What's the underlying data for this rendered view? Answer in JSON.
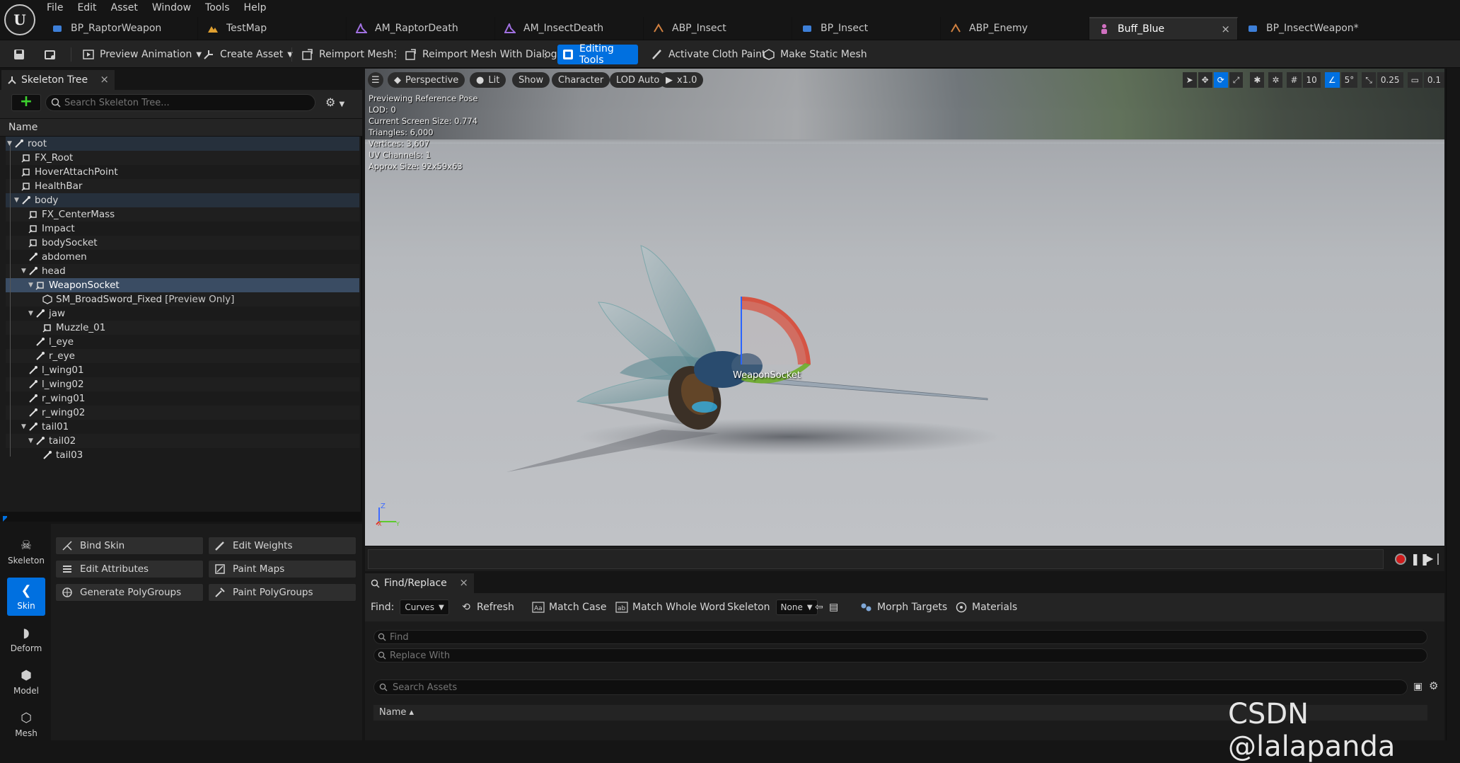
{
  "menu": [
    "File",
    "Edit",
    "Asset",
    "Window",
    "Tools",
    "Help"
  ],
  "tabs": [
    {
      "label": "BP_RaptorWeapon",
      "icon": "blueprint-icon"
    },
    {
      "label": "TestMap",
      "icon": "level-icon"
    },
    {
      "label": "AM_RaptorDeath",
      "icon": "anim-montage-icon"
    },
    {
      "label": "AM_InsectDeath",
      "icon": "anim-montage-icon"
    },
    {
      "label": "ABP_Insect",
      "icon": "anim-blueprint-icon"
    },
    {
      "label": "BP_Insect",
      "icon": "blueprint-icon"
    },
    {
      "label": "ABP_Enemy",
      "icon": "anim-blueprint-icon"
    },
    {
      "label": "Buff_Blue",
      "icon": "skeletal-mesh-icon",
      "active": true,
      "close": "×"
    },
    {
      "label": "BP_InsectWeapon*",
      "icon": "blueprint-icon"
    }
  ],
  "toolbar": {
    "preview_animation": "Preview Animation",
    "create_asset": "Create Asset",
    "reimport_mesh": "Reimport Mesh",
    "reimport_dialog": "Reimport Mesh With Dialog",
    "editing_tools": "Editing Tools",
    "cloth_paint": "Activate Cloth Paint",
    "static_mesh": "Make Static Mesh"
  },
  "skeleton_tree": {
    "tab_label": "Skeleton Tree",
    "close": "×",
    "search_placeholder": "Search Skeleton Tree...",
    "column": "Name",
    "rows": [
      {
        "label": "root",
        "type": "bone",
        "depth": 0,
        "arrow": true
      },
      {
        "label": "FX_Root",
        "type": "socket",
        "depth": 1
      },
      {
        "label": "HoverAttachPoint",
        "type": "socket",
        "depth": 1
      },
      {
        "label": "HealthBar",
        "type": "socket",
        "depth": 1
      },
      {
        "label": "body",
        "type": "bone",
        "depth": 1,
        "arrow": true
      },
      {
        "label": "FX_CenterMass",
        "type": "socket",
        "depth": 2
      },
      {
        "label": "Impact",
        "type": "socket",
        "depth": 2
      },
      {
        "label": "bodySocket",
        "type": "socket",
        "depth": 2
      },
      {
        "label": "abdomen",
        "type": "bone",
        "depth": 2
      },
      {
        "label": "head",
        "type": "bone",
        "depth": 2,
        "arrow": true
      },
      {
        "label": "WeaponSocket",
        "type": "socket",
        "depth": 3,
        "arrow": true,
        "selected": true
      },
      {
        "label": "SM_BroadSword_Fixed",
        "type": "mesh",
        "depth": 4,
        "note": "[Preview Only]"
      },
      {
        "label": "jaw",
        "type": "bone",
        "depth": 3,
        "arrow": true
      },
      {
        "label": "Muzzle_01",
        "type": "socket",
        "depth": 4
      },
      {
        "label": "l_eye",
        "type": "bone",
        "depth": 3
      },
      {
        "label": "r_eye",
        "type": "bone",
        "depth": 3
      },
      {
        "label": "l_wing01",
        "type": "bone",
        "depth": 2
      },
      {
        "label": "l_wing02",
        "type": "bone",
        "depth": 2
      },
      {
        "label": "r_wing01",
        "type": "bone",
        "depth": 2
      },
      {
        "label": "r_wing02",
        "type": "bone",
        "depth": 2
      },
      {
        "label": "tail01",
        "type": "bone",
        "depth": 2,
        "arrow": true
      },
      {
        "label": "tail02",
        "type": "bone",
        "depth": 3,
        "arrow": true
      },
      {
        "label": "tail03",
        "type": "bone",
        "depth": 4
      }
    ]
  },
  "modes": {
    "rail": [
      {
        "label": "Skeleton",
        "icon": "skeleton-icon"
      },
      {
        "label": "Skin",
        "icon": "skin-icon",
        "active": true
      },
      {
        "label": "Deform",
        "icon": "deform-icon"
      },
      {
        "label": "Model",
        "icon": "model-icon"
      },
      {
        "label": "Mesh",
        "icon": "mesh-icon"
      }
    ],
    "buttons": [
      {
        "label": "Bind Skin",
        "icon": "bind-skin-icon"
      },
      {
        "label": "Edit Weights",
        "icon": "edit-weights-icon"
      },
      {
        "label": "Edit Attributes",
        "icon": "edit-attributes-icon"
      },
      {
        "label": "Paint Maps",
        "icon": "paint-maps-icon"
      },
      {
        "label": "Generate PolyGroups",
        "icon": "generate-polygroups-icon"
      },
      {
        "label": "Paint PolyGroups",
        "icon": "paint-polygroups-icon"
      }
    ]
  },
  "viewport": {
    "perspective": "Perspective",
    "lit": "Lit",
    "show": "Show",
    "character": "Character",
    "lod": "LOD Auto",
    "play_rate": "x1.0",
    "grid_size": "10",
    "rot_snap": "5°",
    "scale_snap": "0.25",
    "cam_speed": "0.1",
    "stats": [
      "Previewing Reference Pose",
      "LOD: 0",
      "Current Screen Size: 0.774",
      "Triangles: 6,000",
      "Vertices: 3,607",
      "UV Channels: 1",
      "Approx Size: 92x59x63"
    ],
    "socket_label": "WeaponSocket",
    "axis_z": "Z",
    "axis_x": "X",
    "axis_y": "Y"
  },
  "find_replace": {
    "tab_label": "Find/Replace",
    "close": "×",
    "find_label": "Find:",
    "find_type": "Curves",
    "refresh": "Refresh",
    "match_case": "Match Case",
    "match_whole_word": "Match Whole Word",
    "skeleton_label": "Skeleton",
    "skeleton_value": "None",
    "morph_targets": "Morph Targets",
    "materials": "Materials",
    "find_placeholder": "Find",
    "replace_placeholder": "Replace With",
    "assets_placeholder": "Search Assets",
    "name_col": "Name ▴"
  },
  "watermark": "CSDN @lalapanda",
  "colors": {
    "accent": "#0070e0",
    "add_green": "#3cd22e",
    "record_red": "#d01c1c"
  }
}
